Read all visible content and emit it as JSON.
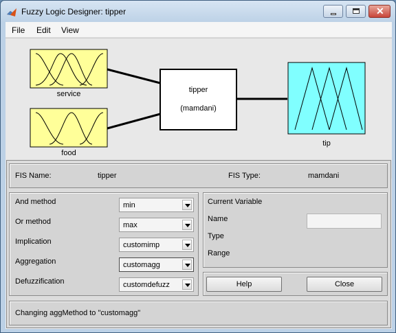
{
  "window": {
    "title": "Fuzzy Logic Designer: tipper"
  },
  "menu": {
    "items": [
      {
        "label": "File"
      },
      {
        "label": "Edit"
      },
      {
        "label": "View"
      }
    ]
  },
  "diagram": {
    "inputs": [
      {
        "name": "service",
        "color": "#ffff99"
      },
      {
        "name": "food",
        "color": "#ffff99"
      }
    ],
    "system": {
      "name": "tipper",
      "type": "(mamdani)"
    },
    "output": {
      "name": "tip",
      "color": "#80ffff"
    }
  },
  "fis_info": {
    "name_label": "FIS Name:",
    "name_value": "tipper",
    "type_label": "FIS Type:",
    "type_value": "mamdani"
  },
  "methods": [
    {
      "label": "And method",
      "value": "min"
    },
    {
      "label": "Or method",
      "value": "max"
    },
    {
      "label": "Implication",
      "value": "customimp"
    },
    {
      "label": "Aggregation",
      "value": "customagg"
    },
    {
      "label": "Defuzzification",
      "value": "customdefuzz"
    }
  ],
  "current_variable": {
    "title": "Current Variable",
    "name_label": "Name",
    "name_value": "",
    "type_label": "Type",
    "range_label": "Range"
  },
  "buttons": {
    "help": "Help",
    "close": "Close"
  },
  "status": {
    "text": "Changing aggMethod to \"customagg\""
  }
}
